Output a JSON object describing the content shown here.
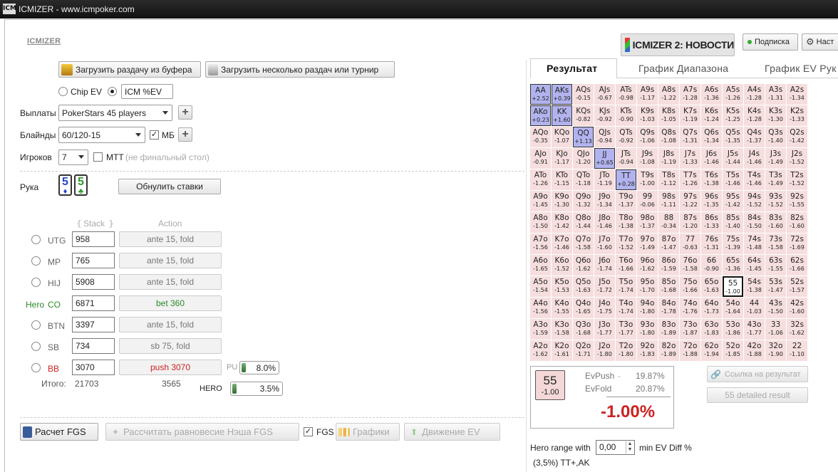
{
  "window": {
    "icon": "ICM",
    "title": "ICMIZER - www.icmpoker.com"
  },
  "app": {
    "link": "ICMIZER"
  },
  "header": {
    "news_button": "ICMIZER 2: НОВОСТИ",
    "subscription": "Подписка",
    "settings": "Наст"
  },
  "load": {
    "from_buffer": "Загрузить раздачу из буфера",
    "multiple": "Загрузить несколько раздач или турнир"
  },
  "model": {
    "chip_ev": "Chip EV",
    "icm_value": "ICM %EV"
  },
  "settings": {
    "payouts_label": "Выплаты",
    "payouts_value": "PokerStars 45 players",
    "blinds_label": "Блайнды",
    "blinds_value": "60/120-15",
    "mb_label": "МБ",
    "players_label": "Игроков",
    "players_value": "7",
    "mtt_label": "МТТ",
    "mtt_note": "(не финальный стол)"
  },
  "hand": {
    "label": "Рука",
    "card1": {
      "rank": "5",
      "suit": "♦",
      "color": "#2244cc"
    },
    "card2": {
      "rank": "5",
      "suit": "♣",
      "color": "#2a9a2a"
    },
    "reset": "Обнулить ставки"
  },
  "table": {
    "stack_header": "Stack",
    "action_header": "Action",
    "players": [
      {
        "prefix": "",
        "pos": "UTG",
        "stack": "958",
        "action": "ante 15, fold"
      },
      {
        "prefix": "",
        "pos": "MP",
        "stack": "765",
        "action": "ante 15, fold"
      },
      {
        "prefix": "",
        "pos": "HIJ",
        "stack": "5908",
        "action": "ante 15, fold"
      },
      {
        "prefix": "Hero",
        "pos": "CO",
        "stack": "6871",
        "action": "bet 360"
      },
      {
        "prefix": "",
        "pos": "BTN",
        "stack": "3397",
        "action": "ante 15, fold"
      },
      {
        "prefix": "",
        "pos": "SB",
        "stack": "734",
        "action": "sb 75, fold"
      },
      {
        "prefix": "",
        "pos": "BB",
        "stack": "3070",
        "action": "push 3070"
      }
    ],
    "total_label": "Итого:",
    "total_stack": "21703",
    "total_action": "3565",
    "pu_label": "PU",
    "pu_value": "8.0%",
    "pu_fraction": 0.08,
    "hero_label": "HERO",
    "hero_value": "3.5%",
    "hero_fraction": 0.035
  },
  "bottom": {
    "calc": "Расчет FGS",
    "nash": "Рассчитать равновесие Нэша FGS",
    "fgs": "FGS",
    "charts": "Графики",
    "ev_move": "Движение EV"
  },
  "tabs": [
    "Результат",
    "График Диапазона",
    "График EV Рук"
  ],
  "grid": {
    "labels": [
      [
        "AA",
        "AKs",
        "AQs",
        "AJs",
        "ATs",
        "A9s",
        "A8s",
        "A7s",
        "A6s",
        "A5s",
        "A4s",
        "A3s",
        "A2s"
      ],
      [
        "AKo",
        "KK",
        "KQs",
        "KJs",
        "KTs",
        "K9s",
        "K8s",
        "K7s",
        "K6s",
        "K5s",
        "K4s",
        "K3s",
        "K2s"
      ],
      [
        "AQo",
        "KQo",
        "QQ",
        "QJs",
        "QTs",
        "Q9s",
        "Q8s",
        "Q7s",
        "Q6s",
        "Q5s",
        "Q4s",
        "Q3s",
        "Q2s"
      ],
      [
        "AJo",
        "KJo",
        "QJo",
        "JJ",
        "JTs",
        "J9s",
        "J8s",
        "J7s",
        "J6s",
        "J5s",
        "J4s",
        "J3s",
        "J2s"
      ],
      [
        "ATo",
        "KTo",
        "QTo",
        "JTo",
        "TT",
        "T9s",
        "T8s",
        "T7s",
        "T6s",
        "T5s",
        "T4s",
        "T3s",
        "T2s"
      ],
      [
        "A9o",
        "K9o",
        "Q9o",
        "J9o",
        "T9o",
        "99",
        "98s",
        "97s",
        "96s",
        "95s",
        "94s",
        "93s",
        "92s"
      ],
      [
        "A8o",
        "K8o",
        "Q8o",
        "J8o",
        "T8o",
        "98o",
        "88",
        "87s",
        "86s",
        "85s",
        "84s",
        "83s",
        "82s"
      ],
      [
        "A7o",
        "K7o",
        "Q7o",
        "J7o",
        "T7o",
        "97o",
        "87o",
        "77",
        "76s",
        "75s",
        "74s",
        "73s",
        "72s"
      ],
      [
        "A6o",
        "K6o",
        "Q6o",
        "J6o",
        "T6o",
        "96o",
        "86o",
        "76o",
        "66",
        "65s",
        "64s",
        "63s",
        "62s"
      ],
      [
        "A5o",
        "K5o",
        "Q5o",
        "J5o",
        "T5o",
        "95o",
        "85o",
        "75o",
        "65o",
        "55",
        "54s",
        "53s",
        "52s"
      ],
      [
        "A4o",
        "K4o",
        "Q4o",
        "J4o",
        "T4o",
        "94o",
        "84o",
        "74o",
        "64o",
        "54o",
        "44",
        "43s",
        "42s"
      ],
      [
        "A3o",
        "K3o",
        "Q3o",
        "J3o",
        "T3o",
        "93o",
        "83o",
        "73o",
        "63o",
        "53o",
        "43o",
        "33",
        "32s"
      ],
      [
        "A2o",
        "K2o",
        "Q2o",
        "J2o",
        "T2o",
        "92o",
        "82o",
        "72o",
        "62o",
        "52o",
        "42o",
        "32o",
        "22"
      ]
    ],
    "ev": [
      [
        "+2.52",
        "+0.39",
        "-0.15",
        "-0.67",
        "-0.98",
        "-1.17",
        "-1.22",
        "-1.28",
        "-1.36",
        "-1.26",
        "-1.28",
        "-1.31",
        "-1.34"
      ],
      [
        "+0.23",
        "+1.60",
        "-0.82",
        "-0.92",
        "-0.90",
        "-1.03",
        "-1.05",
        "-1.19",
        "-1.24",
        "-1.25",
        "-1.28",
        "-1.30",
        "-1.33"
      ],
      [
        "-0.35",
        "-1.07",
        "+1.13",
        "-0.94",
        "-0.92",
        "-1.06",
        "-1.08",
        "-1.31",
        "-1.34",
        "-1.35",
        "-1.37",
        "-1.40",
        "-1.42"
      ],
      [
        "-0.91",
        "-1.17",
        "-1.20",
        "+0.65",
        "-0.94",
        "-1.08",
        "-1.19",
        "-1.33",
        "-1.46",
        "-1.44",
        "-1.46",
        "-1.49",
        "-1.52"
      ],
      [
        "-1.26",
        "-1.15",
        "-1.18",
        "-1.19",
        "+0.28",
        "-1.00",
        "-1.12",
        "-1.26",
        "-1.38",
        "-1.46",
        "-1.46",
        "-1.49",
        "-1.52"
      ],
      [
        "-1.45",
        "-1.30",
        "-1.32",
        "-1.34",
        "-1.37",
        "-0.06",
        "-1.11",
        "-1.22",
        "-1.35",
        "-1.42",
        "-1.52",
        "-1.52",
        "-1.55"
      ],
      [
        "-1.50",
        "-1.42",
        "-1.44",
        "-1.46",
        "-1.38",
        "-1.37",
        "-0.34",
        "-1.20",
        "-1.33",
        "-1.40",
        "-1.50",
        "-1.60",
        "-1.60"
      ],
      [
        "-1.56",
        "-1.46",
        "-1.58",
        "-1.60",
        "-1.52",
        "-1.49",
        "-1.47",
        "-0.63",
        "-1.31",
        "-1.39",
        "-1.48",
        "-1.58",
        "-1.69"
      ],
      [
        "-1.65",
        "-1.52",
        "-1.62",
        "-1.74",
        "-1.66",
        "-1.62",
        "-1.59",
        "-1.58",
        "-0.90",
        "-1.36",
        "-1.45",
        "-1.55",
        "-1.66"
      ],
      [
        "-1.54",
        "-1.53",
        "-1.63",
        "-1.72",
        "-1.74",
        "-1.70",
        "-1.68",
        "-1.66",
        "-1.63",
        "-1.00",
        "-1.38",
        "-1.47",
        "-1.57"
      ],
      [
        "-1.56",
        "-1.55",
        "-1.65",
        "-1.75",
        "-1.74",
        "-1.80",
        "-1.78",
        "-1.76",
        "-1.73",
        "-1.64",
        "-1.03",
        "-1.50",
        "-1.60"
      ],
      [
        "-1.59",
        "-1.58",
        "-1.68",
        "-1.77",
        "-1.77",
        "-1.80",
        "-1.89",
        "-1.87",
        "-1.83",
        "-1.86",
        "-1.77",
        "-1.06",
        "-1.62"
      ],
      [
        "-1.62",
        "-1.61",
        "-1.71",
        "-1.80",
        "-1.80",
        "-1.83",
        "-1.89",
        "-1.88",
        "-1.94",
        "-1.85",
        "-1.88",
        "-1.90",
        "-1.10"
      ]
    ],
    "range": [
      "AA",
      "AKs",
      "AKo",
      "KK",
      "QQ",
      "JJ",
      "TT"
    ],
    "current": "55"
  },
  "result": {
    "hand": "55",
    "hand_ev": "-1.00",
    "evpush_label": "EvPush",
    "evpush": "19.87%",
    "evfold_label": "EvFold",
    "evfold": "20.87%",
    "diff": "-1.00%"
  },
  "side": {
    "link_button": "Ссылка на результат",
    "detailed": "55 detailed result"
  },
  "range": {
    "label": "Hero range with",
    "value": "0,00",
    "suffix": "min EV Diff %",
    "summary": "(3,5%) TT+,AK"
  },
  "colors": {
    "in_range": "#b2b3ee",
    "out_range": "#f6dede",
    "diff": "#cc2222",
    "hero": "#2a8a2a",
    "bb": "#cc2222"
  }
}
